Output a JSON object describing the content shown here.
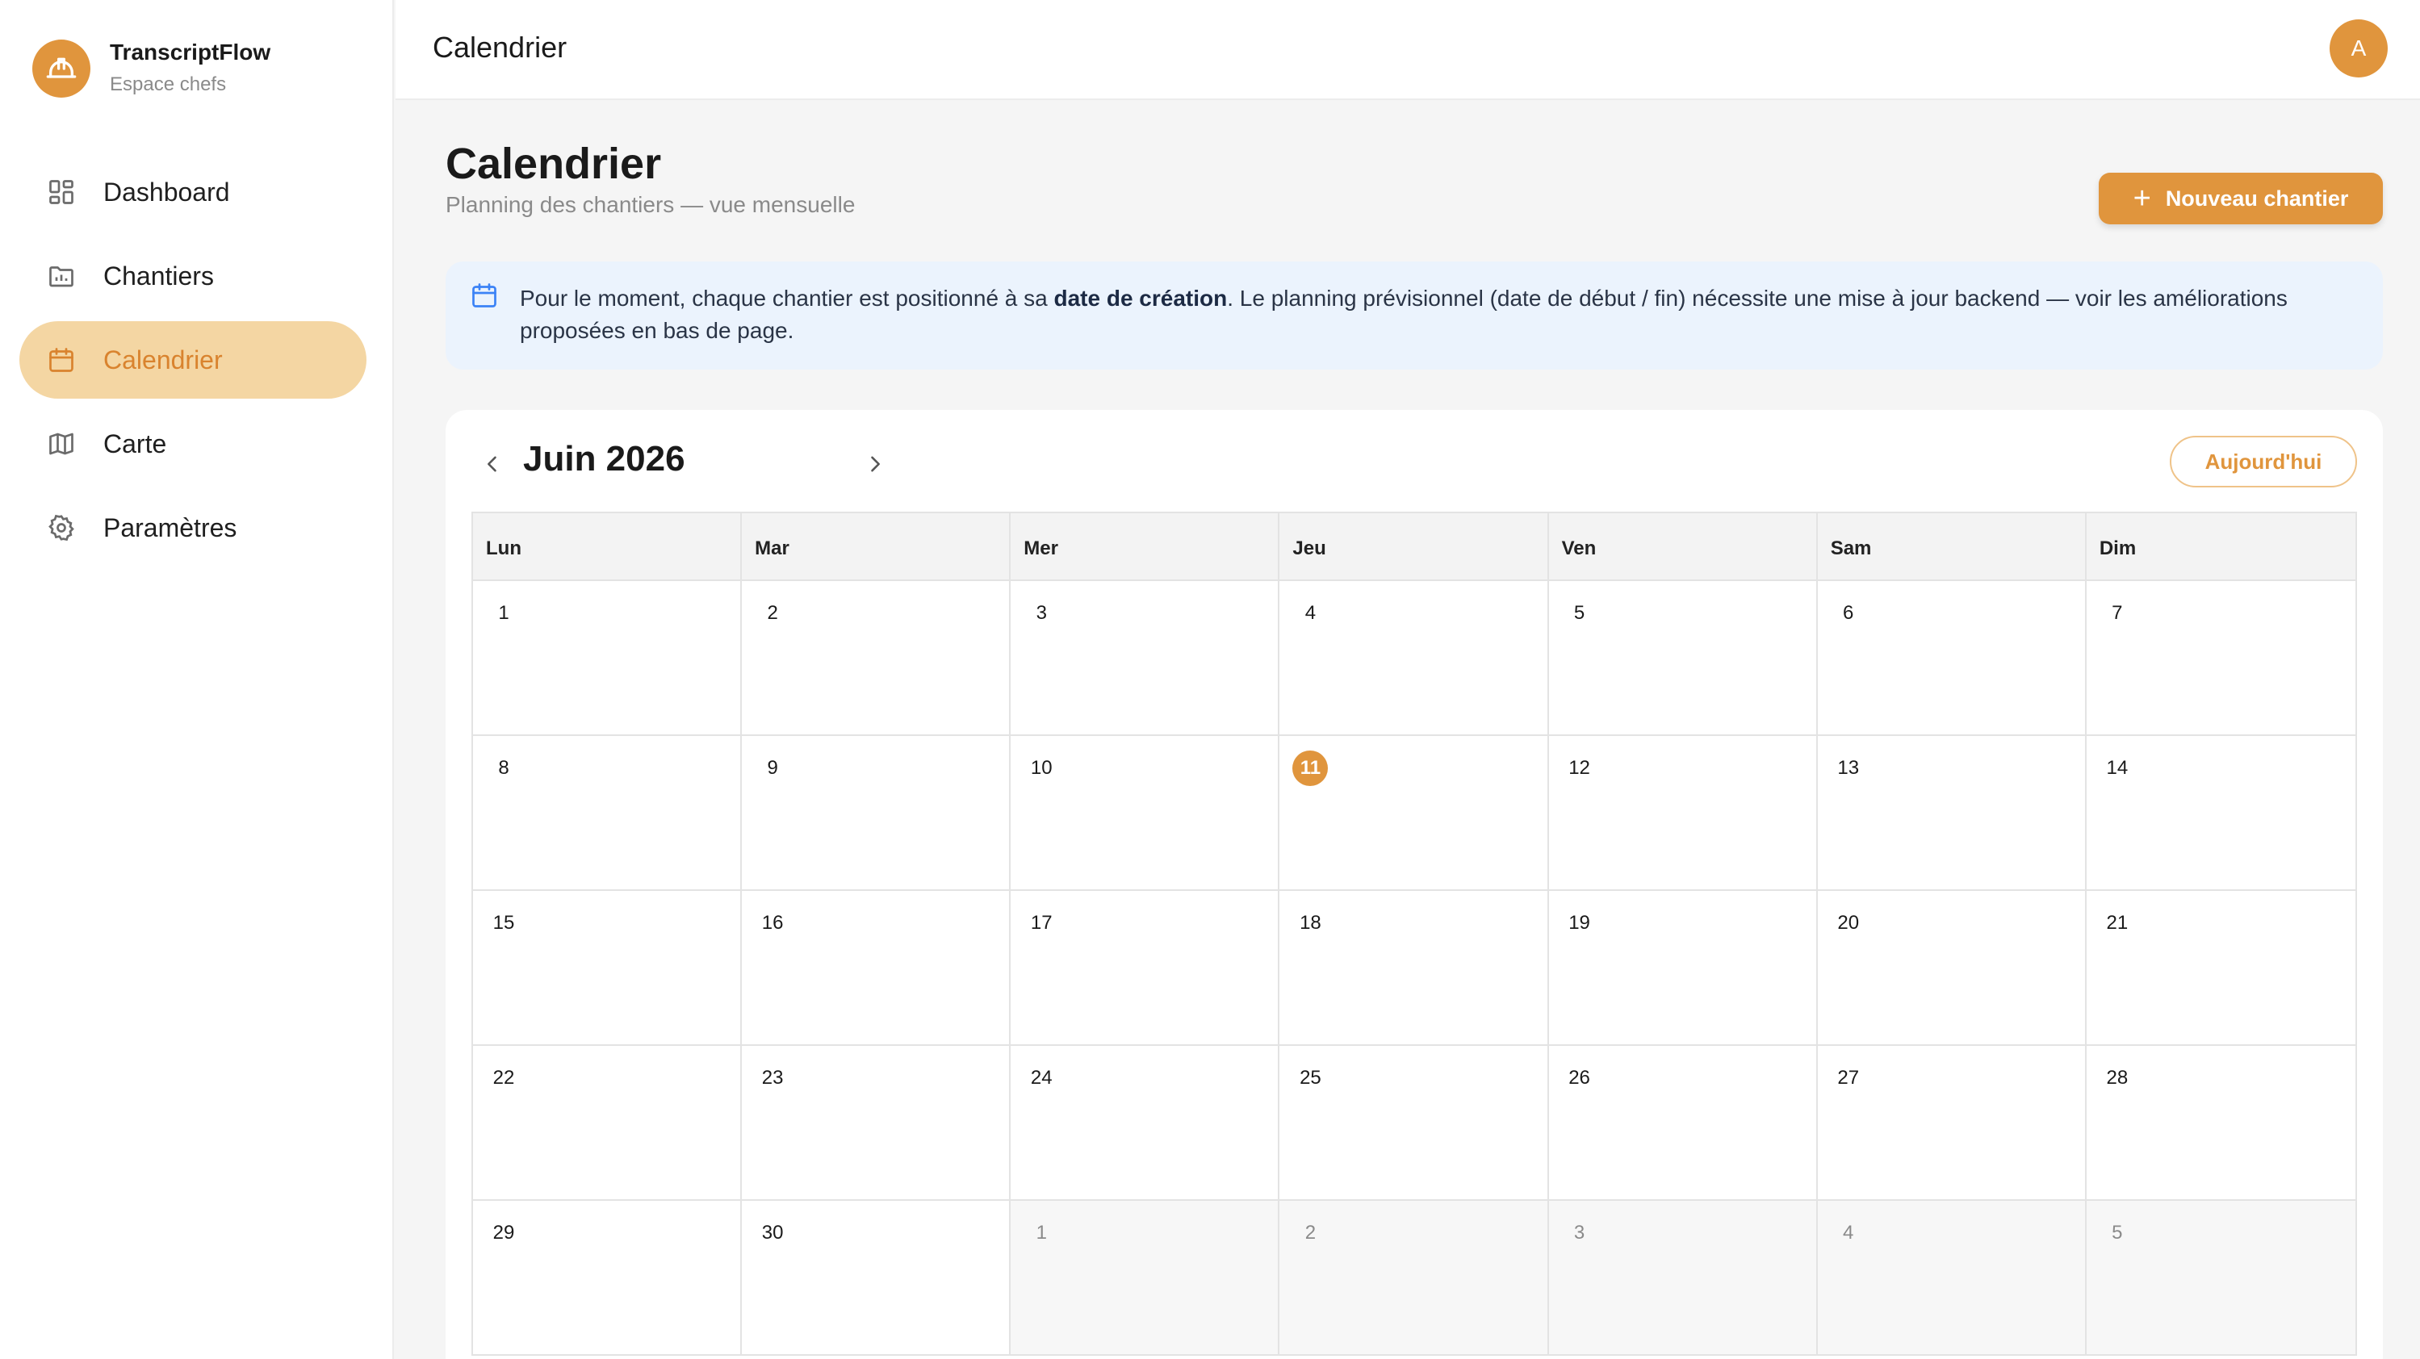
{
  "brand": {
    "name": "TranscriptFlow",
    "subtitle": "Espace chefs",
    "logo_icon": "hard-hat-icon"
  },
  "sidebar": {
    "items": [
      {
        "label": "Dashboard",
        "icon": "grid-icon",
        "active": false
      },
      {
        "label": "Chantiers",
        "icon": "folder-icon",
        "active": false
      },
      {
        "label": "Calendrier",
        "icon": "calendar-icon",
        "active": true
      },
      {
        "label": "Carte",
        "icon": "map-icon",
        "active": false
      },
      {
        "label": "Paramètres",
        "icon": "gear-icon",
        "active": false
      }
    ]
  },
  "topbar": {
    "title": "Calendrier",
    "avatar_initial": "A"
  },
  "page": {
    "title": "Calendrier",
    "subtitle": "Planning des chantiers — vue mensuelle",
    "new_button": "Nouveau chantier"
  },
  "notice": {
    "before": "Pour le moment, chaque chantier est positionné à sa ",
    "bold": "date de création",
    "after": ". Le planning prévisionnel (date de début / fin) nécessite une mise à jour backend — voir les améliorations proposées en bas de page."
  },
  "calendar": {
    "month_label": "Juin 2026",
    "today_button": "Aujourd'hui",
    "weekdays": [
      "Lun",
      "Mar",
      "Mer",
      "Jeu",
      "Ven",
      "Sam",
      "Dim"
    ],
    "today": 11,
    "days": [
      {
        "n": "1",
        "other": false
      },
      {
        "n": "2",
        "other": false
      },
      {
        "n": "3",
        "other": false
      },
      {
        "n": "4",
        "other": false
      },
      {
        "n": "5",
        "other": false
      },
      {
        "n": "6",
        "other": false
      },
      {
        "n": "7",
        "other": false
      },
      {
        "n": "8",
        "other": false
      },
      {
        "n": "9",
        "other": false
      },
      {
        "n": "10",
        "other": false
      },
      {
        "n": "11",
        "other": false
      },
      {
        "n": "12",
        "other": false
      },
      {
        "n": "13",
        "other": false
      },
      {
        "n": "14",
        "other": false
      },
      {
        "n": "15",
        "other": false
      },
      {
        "n": "16",
        "other": false
      },
      {
        "n": "17",
        "other": false
      },
      {
        "n": "18",
        "other": false
      },
      {
        "n": "19",
        "other": false
      },
      {
        "n": "20",
        "other": false
      },
      {
        "n": "21",
        "other": false
      },
      {
        "n": "22",
        "other": false
      },
      {
        "n": "23",
        "other": false
      },
      {
        "n": "24",
        "other": false
      },
      {
        "n": "25",
        "other": false
      },
      {
        "n": "26",
        "other": false
      },
      {
        "n": "27",
        "other": false
      },
      {
        "n": "28",
        "other": false
      },
      {
        "n": "29",
        "other": false
      },
      {
        "n": "30",
        "other": false
      },
      {
        "n": "1",
        "other": true
      },
      {
        "n": "2",
        "other": true
      },
      {
        "n": "3",
        "other": true
      },
      {
        "n": "4",
        "other": true
      },
      {
        "n": "5",
        "other": true
      }
    ]
  },
  "colors": {
    "accent": "#e0953d",
    "accent_soft": "#f4d6a3",
    "notice_bg": "#ebf3fd",
    "notice_icon": "#3b82f6"
  }
}
